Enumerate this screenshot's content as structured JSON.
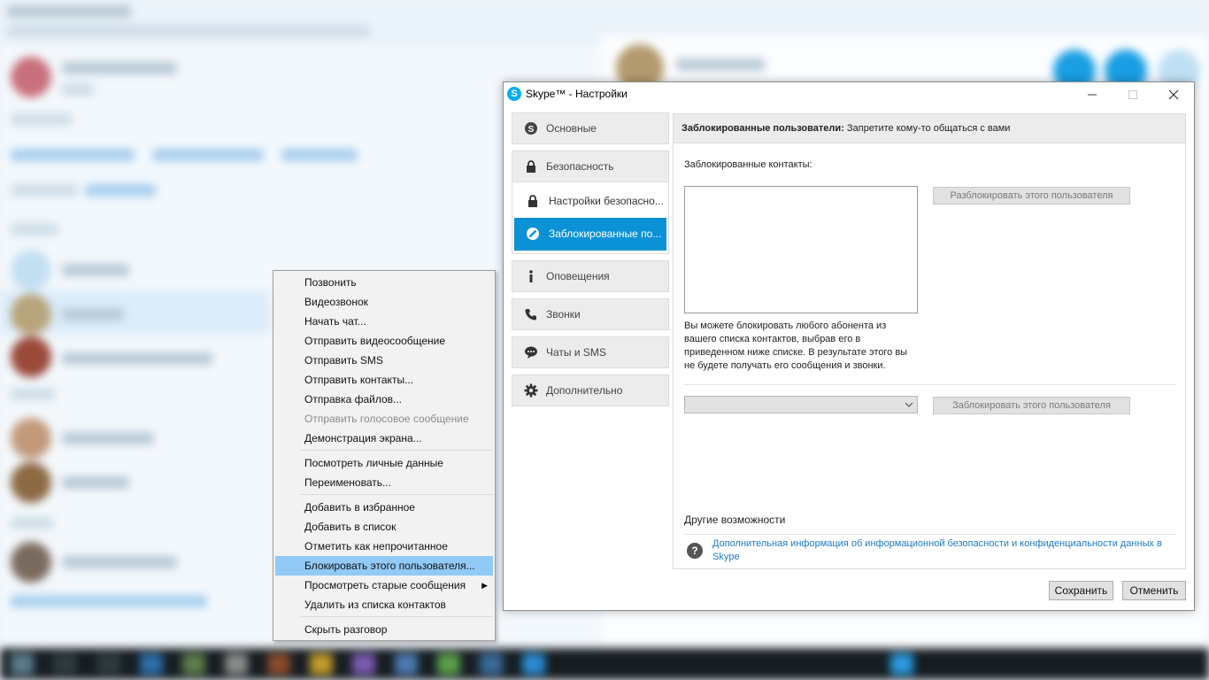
{
  "dialog": {
    "title": "Skype™ - Настройки",
    "logo_icon": "skype-logo-icon",
    "window_controls": [
      "minimize",
      "maximize",
      "close"
    ],
    "nav": {
      "general": "Основные",
      "security": "Безопасность",
      "security_settings": "Настройки безопасно...",
      "blocked_users": "Заблокированные по...",
      "notifications": "Оповещения",
      "calls": "Звонки",
      "chats_sms": "Чаты и SMS",
      "advanced": "Дополнительно"
    },
    "panel": {
      "header_bold": "Заблокированные пользователи:",
      "header_rest": " Запретите кому-то общаться с вами",
      "blocked_contacts_label": "Заблокированные контакты:",
      "unblock_button": "Разблокировать этого пользователя",
      "description": "Вы можете блокировать любого абонента из вашего списка контактов, выбрав его в приведенном ниже списке. В результате этого вы не будете получать его сообщения и звонки.",
      "contact_combo_value": "",
      "block_button": "Заблокировать этого пользователя",
      "other_options_label": "Другие возможности",
      "privacy_link": "Дополнительная информация об информационной безопасности и конфиденциальности данных в Skype"
    },
    "save_button": "Сохранить",
    "cancel_button": "Отменить",
    "accent_color": "#0a91d6"
  },
  "context_menu": {
    "items": [
      {
        "label": "Позвонить"
      },
      {
        "label": "Видеозвонок"
      },
      {
        "label": "Начать чат..."
      },
      {
        "label": "Отправить видеосообщение"
      },
      {
        "label": "Отправить SMS"
      },
      {
        "label": "Отправить контакты..."
      },
      {
        "label": "Отправка файлов..."
      },
      {
        "label": "Отправить голосовое сообщение"
      },
      {
        "label": "Демонстрация экрана..."
      },
      {
        "label": "Посмотреть личные данные"
      },
      {
        "label": "Переименовать..."
      },
      {
        "label": "Добавить в избранное"
      },
      {
        "label": "Добавить в список"
      },
      {
        "label": "Отметить как непрочитанное"
      },
      {
        "label": "Блокировать этого пользователя..."
      },
      {
        "label": "Просмотреть старые сообщения"
      },
      {
        "label": "Удалить из списка контактов"
      },
      {
        "label": "Скрыть разговор"
      }
    ],
    "highlight_color": "#91c9f7"
  }
}
